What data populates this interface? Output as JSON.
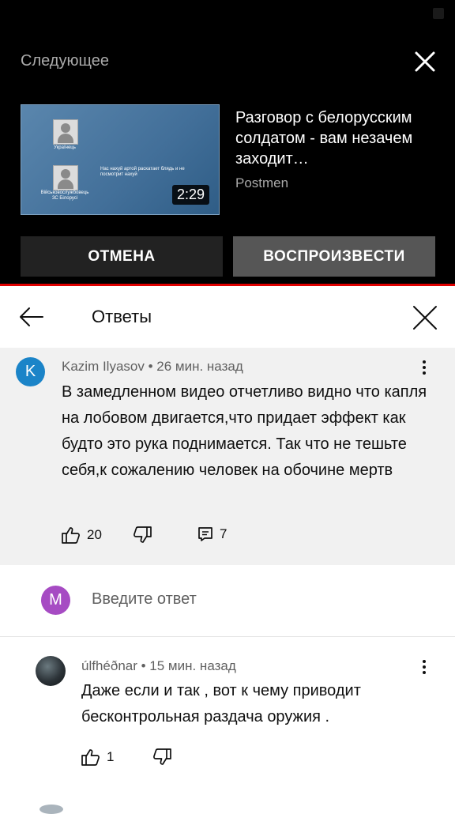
{
  "up_next": {
    "heading": "Следующее",
    "video": {
      "title": "Разговор с белорусским солдатом - вам незачем заходит…",
      "channel": "Postmen",
      "duration": "2:29",
      "thumbnail_labels": {
        "top_person": "Українець",
        "bottom_person": "Військовослужбовець ЗС Білорусі",
        "caption": "Нас нахуй артой раскатает блядь и не посмотрит нахуй"
      }
    },
    "cancel_label": "ОТМЕНА",
    "play_label": "ВОСПРОИЗВЕСТИ"
  },
  "replies_panel": {
    "title": "Ответы"
  },
  "parent_comment": {
    "avatar_letter": "K",
    "avatar_color": "#1b84c8",
    "meta": "Kazim Ilyasov • 26 мин. назад",
    "text": "В замедленном видео отчетливо видно что капля на лобовом двигается,что придает эффект как будто это рука поднимается. Так что не тешьте себя,к сожалению человек на обочине мертв",
    "likes": "20",
    "replies_count": "7"
  },
  "reply_box": {
    "avatar_letter": "M",
    "avatar_color": "#a64bc3",
    "placeholder": "Введите ответ"
  },
  "reply_comment": {
    "meta": "úlfhéðnar • 15 мин. назад",
    "text": "Даже если и так , вот к чему приводит бесконтрольная раздача оружия .",
    "likes": "1"
  },
  "icons": [
    "close-icon",
    "back-arrow-icon",
    "more-vert-icon",
    "thumb-up-icon",
    "thumb-down-icon",
    "comment-icon"
  ]
}
